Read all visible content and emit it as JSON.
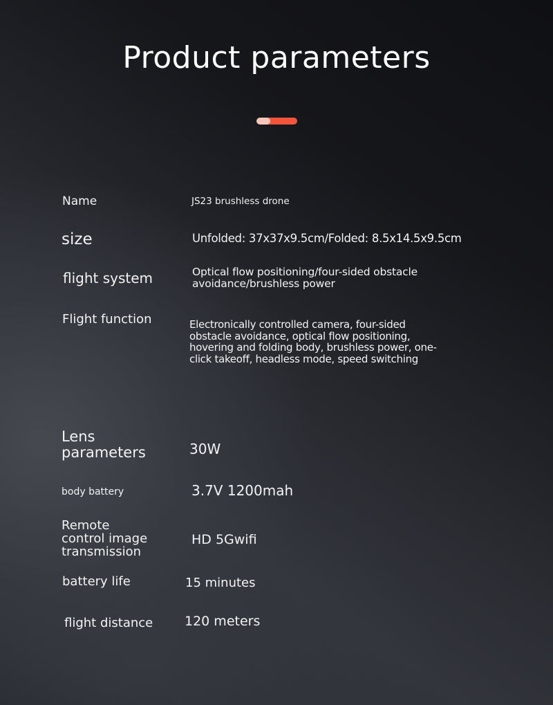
{
  "page": {
    "title": "Product parameters",
    "accent_colors": {
      "primary": "#f2553b",
      "highlight": "#f6c6bc"
    }
  },
  "params": [
    {
      "label": "Name",
      "value": "JS23 brushless drone"
    },
    {
      "label": "size",
      "value": "Unfolded: 37x37x9.5cm/Folded: 8.5x14.5x9.5cm"
    },
    {
      "label": "flight system",
      "value": "Optical flow positioning/four-sided obstacle\navoidance/brushless power"
    },
    {
      "label": "Flight function",
      "value": "Electronically controlled camera, four-sided\nobstacle avoidance, optical flow positioning,\nhovering and folding body, brushless power, one-\nclick takeoff, headless mode, speed switching"
    },
    {
      "label": "Lens\nparameters",
      "value": "30W"
    },
    {
      "label": "body battery",
      "value": "3.7V 1200mah"
    },
    {
      "label": "Remote\ncontrol image\ntransmission",
      "value": "HD 5Gwifi"
    },
    {
      "label": "battery life",
      "value": "15 minutes"
    },
    {
      "label": "flight distance",
      "value": "120 meters"
    }
  ]
}
